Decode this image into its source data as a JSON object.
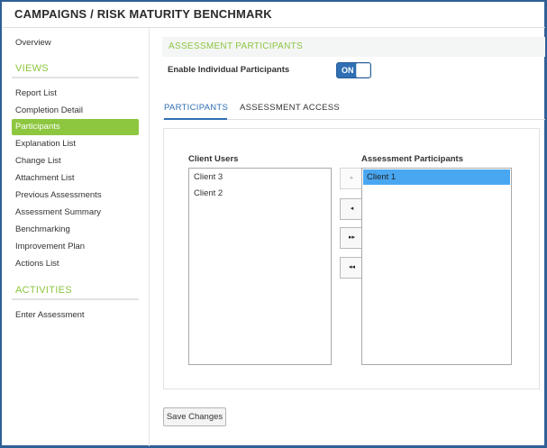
{
  "header": {
    "title": "CAMPAIGNS / RISK MATURITY BENCHMARK"
  },
  "sidebar": {
    "overview": "Overview",
    "views_heading": "VIEWS",
    "views": [
      "Report List",
      "Completion Detail",
      "Participants",
      "Explanation List",
      "Change List",
      "Attachment List",
      "Previous Assessments",
      "Assessment Summary",
      "Benchmarking",
      "Improvement Plan",
      "Actions List"
    ],
    "active_view": "Participants",
    "activities_heading": "ACTIVITIES",
    "activities": [
      "Enter Assessment"
    ]
  },
  "main": {
    "section_title": "ASSESSMENT PARTICIPANTS",
    "enable_label": "Enable Individual Participants",
    "toggle_text": "ON",
    "toggle_state": "on",
    "tabs": [
      {
        "label": "PARTICIPANTS",
        "active": true
      },
      {
        "label": "ASSESSMENT ACCESS",
        "active": false
      }
    ],
    "client_users": {
      "label": "Client Users",
      "items": [
        "Client 3",
        "Client 2"
      ]
    },
    "assessment_participants": {
      "label": "Assessment Participants",
      "items": [
        "Client 1"
      ],
      "selected": "Client 1"
    },
    "move_buttons": [
      {
        "glyph": "▸",
        "enabled": false,
        "icon": "move-right-icon"
      },
      {
        "glyph": "◂",
        "enabled": true,
        "icon": "move-left-icon"
      },
      {
        "glyph": "▸▸",
        "enabled": true,
        "icon": "move-all-right-icon"
      },
      {
        "glyph": "◂◂",
        "enabled": true,
        "icon": "move-all-left-icon"
      }
    ],
    "save_label": "Save Changes"
  },
  "colors": {
    "accent_green": "#8dc63f",
    "accent_blue": "#2f6fb3",
    "selection_blue": "#49a7f2",
    "frame_border": "#2f5f97"
  }
}
